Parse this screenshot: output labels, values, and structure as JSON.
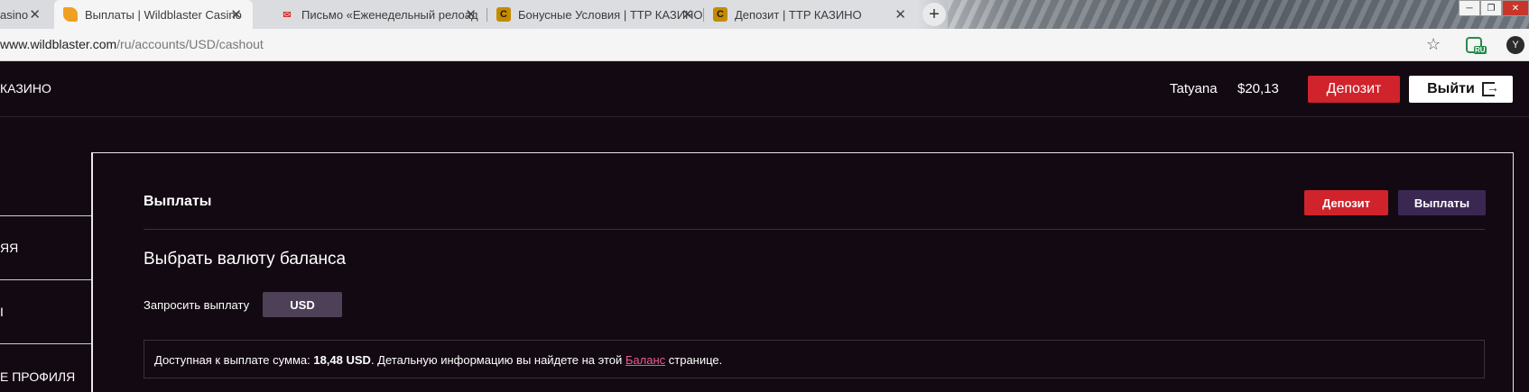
{
  "browser": {
    "tabs": [
      {
        "title": "asino",
        "favicon": "partial"
      },
      {
        "title": "Выплаты | Wildblaster Casino",
        "favicon": "fire-icon",
        "active": true
      },
      {
        "title": "Письмо «Еженедельный релоад",
        "favicon": "gmail-icon"
      },
      {
        "title": "Бонусные Условия | TTP КАЗИНО",
        "favicon": "ttp-icon"
      },
      {
        "title": "Депозит | TTP КАЗИНО",
        "favicon": "ttp-icon"
      }
    ],
    "close_glyph": "✕",
    "new_tab_glyph": "+",
    "url_host": "www.wildblaster.com",
    "url_path": "/ru/accounts/USD/cashout",
    "extension_badge": "RU",
    "profile_initial": "Y"
  },
  "header": {
    "brand": "КАЗИНО",
    "username": "Tatyana",
    "balance": "$20,13",
    "deposit_label": "Депозит",
    "logout_label": "Выйти"
  },
  "sidebar": {
    "items": [
      {
        "label": ""
      },
      {
        "label": "ЯЯ"
      },
      {
        "label": "Ι"
      },
      {
        "label": "Е ПРОФИЛЯ"
      }
    ]
  },
  "main": {
    "title": "Выплаты",
    "deposit_button": "Депозит",
    "payouts_button": "Выплаты",
    "section_title": "Выбрать валюту баланса",
    "request_label": "Запросить выплату",
    "currency": "USD",
    "info_prefix": "Доступная к выплате сумма: ",
    "info_amount": "18,48 USD",
    "info_middle": ". Детальную информацию вы найдете на этой ",
    "info_link": "Баланс",
    "info_suffix": " странице."
  },
  "colors": {
    "background": "#130912",
    "accent_red": "#d0232c",
    "accent_purple": "#3a2853",
    "link": "#e85a8e"
  }
}
